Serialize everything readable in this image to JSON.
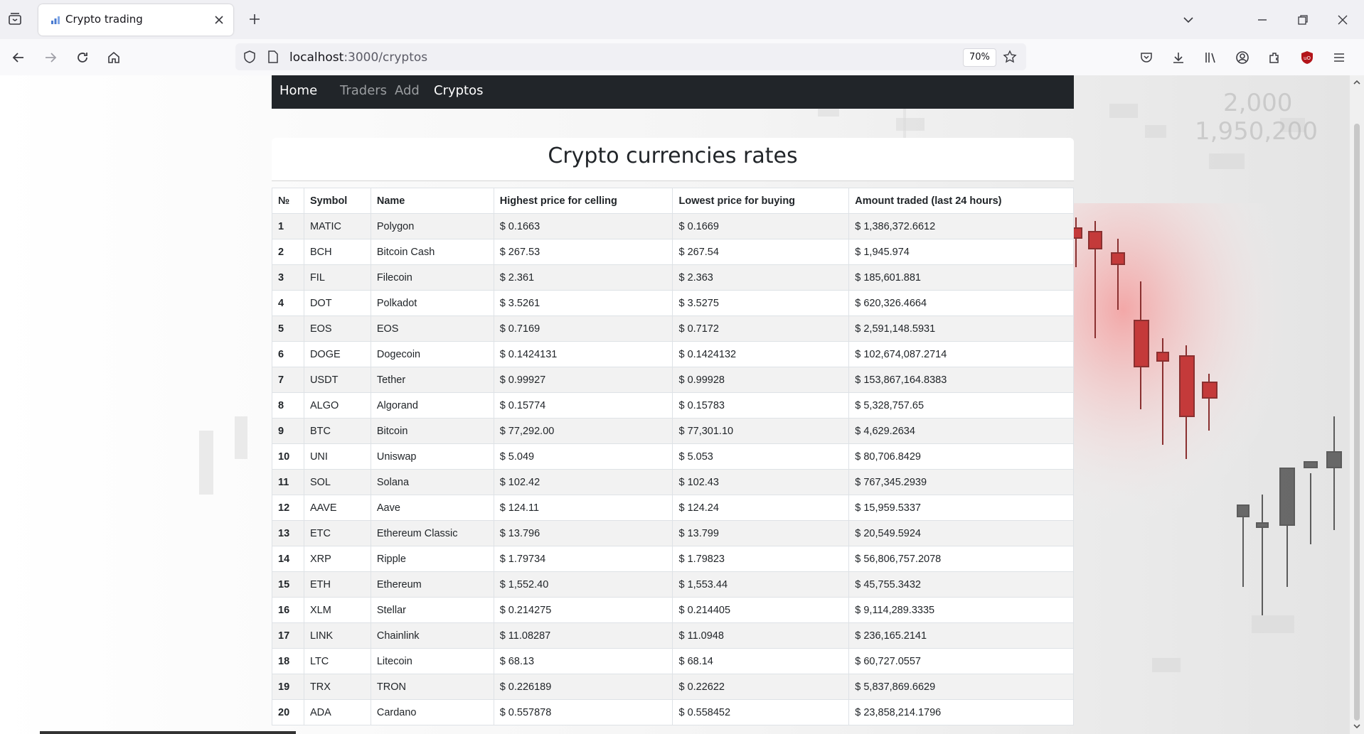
{
  "browser": {
    "tab_title": "Crypto trading",
    "url_host": "localhost",
    "url_path": ":3000/cryptos",
    "zoom": "70%"
  },
  "navbar": {
    "brand": "Home",
    "links": [
      "Traders",
      "Add",
      "Cryptos"
    ]
  },
  "page": {
    "title": "Crypto currencies rates"
  },
  "table": {
    "headers": [
      "№",
      "Symbol",
      "Name",
      "Highest price for celling",
      "Lowest price for buying",
      "Amount traded (last 24 hours)"
    ],
    "rows": [
      [
        "1",
        "MATIC",
        "Polygon",
        "$ 0.1663",
        "$ 0.1669",
        "$ 1,386,372.6612"
      ],
      [
        "2",
        "BCH",
        "Bitcoin Cash",
        "$ 267.53",
        "$ 267.54",
        "$ 1,945.974"
      ],
      [
        "3",
        "FIL",
        "Filecoin",
        "$ 2.361",
        "$ 2.363",
        "$ 185,601.881"
      ],
      [
        "4",
        "DOT",
        "Polkadot",
        "$ 3.5261",
        "$ 3.5275",
        "$ 620,326.4664"
      ],
      [
        "5",
        "EOS",
        "EOS",
        "$ 0.7169",
        "$ 0.7172",
        "$ 2,591,148.5931"
      ],
      [
        "6",
        "DOGE",
        "Dogecoin",
        "$ 0.1424131",
        "$ 0.1424132",
        "$ 102,674,087.2714"
      ],
      [
        "7",
        "USDT",
        "Tether",
        "$ 0.99927",
        "$ 0.99928",
        "$ 153,867,164.8383"
      ],
      [
        "8",
        "ALGO",
        "Algorand",
        "$ 0.15774",
        "$ 0.15783",
        "$ 5,328,757.65"
      ],
      [
        "9",
        "BTC",
        "Bitcoin",
        "$ 77,292.00",
        "$ 77,301.10",
        "$ 4,629.2634"
      ],
      [
        "10",
        "UNI",
        "Uniswap",
        "$ 5.049",
        "$ 5.053",
        "$ 80,706.8429"
      ],
      [
        "11",
        "SOL",
        "Solana",
        "$ 102.42",
        "$ 102.43",
        "$ 767,345.2939"
      ],
      [
        "12",
        "AAVE",
        "Aave",
        "$ 124.11",
        "$ 124.24",
        "$ 15,959.5337"
      ],
      [
        "13",
        "ETC",
        "Ethereum Classic",
        "$ 13.796",
        "$ 13.799",
        "$ 20,549.5924"
      ],
      [
        "14",
        "XRP",
        "Ripple",
        "$ 1.79734",
        "$ 1.79823",
        "$ 56,806,757.2078"
      ],
      [
        "15",
        "ETH",
        "Ethereum",
        "$ 1,552.40",
        "$ 1,553.44",
        "$ 45,755.3432"
      ],
      [
        "16",
        "XLM",
        "Stellar",
        "$ 0.214275",
        "$ 0.214405",
        "$ 9,114,289.3335"
      ],
      [
        "17",
        "LINK",
        "Chainlink",
        "$ 11.08287",
        "$ 11.0948",
        "$ 236,165.2141"
      ],
      [
        "18",
        "LTC",
        "Litecoin",
        "$ 68.13",
        "$ 68.14",
        "$ 60,727.0557"
      ],
      [
        "19",
        "TRX",
        "TRON",
        "$ 0.226189",
        "$ 0.22622",
        "$ 5,837,869.6629"
      ],
      [
        "20",
        "ADA",
        "Cardano",
        "$ 0.557878",
        "$ 0.558452",
        "$ 23,858,214.1796"
      ]
    ]
  },
  "colors": {
    "navbar_bg": "#212529",
    "nav_active": "#ffffff",
    "nav_inactive": "#9a9da0",
    "stripe": "#f2f2f2",
    "accent_red": "#d94a4a"
  },
  "icons": {
    "tab_list": "tab-list-icon",
    "favicon": "chart-favicon-icon",
    "close_tab": "close-icon",
    "new_tab": "plus-icon",
    "back": "back-arrow-icon",
    "forward": "forward-arrow-icon",
    "reload": "reload-icon",
    "home": "home-icon",
    "shield": "shield-icon",
    "page": "page-icon",
    "bookmark": "star-icon",
    "pocket": "pocket-icon",
    "downloads": "download-icon",
    "library": "library-icon",
    "account": "account-icon",
    "extensions": "extensions-icon",
    "ublock": "ublock-icon",
    "menu": "hamburger-menu-icon"
  }
}
